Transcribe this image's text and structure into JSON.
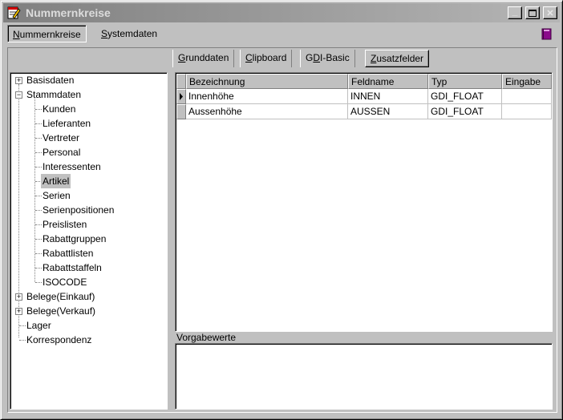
{
  "window": {
    "title": "Nummernkreise",
    "buttons": {
      "minimize": "_",
      "maximize": "□",
      "close": "✕"
    }
  },
  "top_tabs": [
    {
      "mnemonic": "N",
      "rest": "ummernkreise"
    },
    {
      "mnemonic": "S",
      "rest": "ystemdaten"
    }
  ],
  "sub_tabs": [
    {
      "mnemonic": "G",
      "rest": "runddaten"
    },
    {
      "mnemonic": "C",
      "rest": "lipboard"
    },
    {
      "pre": "G",
      "mnemonic": "D",
      "rest": "I-Basic"
    },
    {
      "mnemonic": "Z",
      "rest": "usatzfelder"
    }
  ],
  "tree": {
    "basisdaten": "Basisdaten",
    "stammdaten": "Stammdaten",
    "children": [
      "Kunden",
      "Lieferanten",
      "Vertreter",
      "Personal",
      "Interessenten",
      "Artikel",
      "Serien",
      "Serienpositionen",
      "Preislisten",
      "Rabattgruppen",
      "Rabattlisten",
      "Rabattstaffeln",
      "ISOCODE"
    ],
    "belege_einkauf": "Belege(Einkauf)",
    "belege_verkauf": "Belege(Verkauf)",
    "lager": "Lager",
    "korrespondenz": "Korrespondenz",
    "expander_plus": "+",
    "expander_minus": "−"
  },
  "grid": {
    "headers": [
      "Bezeichnung",
      "Feldname",
      "Typ",
      "Eingabe"
    ],
    "rows": [
      [
        "Innenhöhe",
        "INNEN",
        "GDI_FLOAT",
        ""
      ],
      [
        "Aussenhöhe",
        "AUSSEN",
        "GDI_FLOAT",
        ""
      ]
    ]
  },
  "vorgabewerte_label": "Vorgabewerte",
  "icons": {
    "app": "notepad-pencil-icon",
    "book": "book-icon",
    "row_pointer": "current-row-pointer-icon"
  },
  "colors": {
    "window_bg": "#c0c0c0",
    "title_bg": "#808080",
    "book": "#8b0a8b"
  }
}
